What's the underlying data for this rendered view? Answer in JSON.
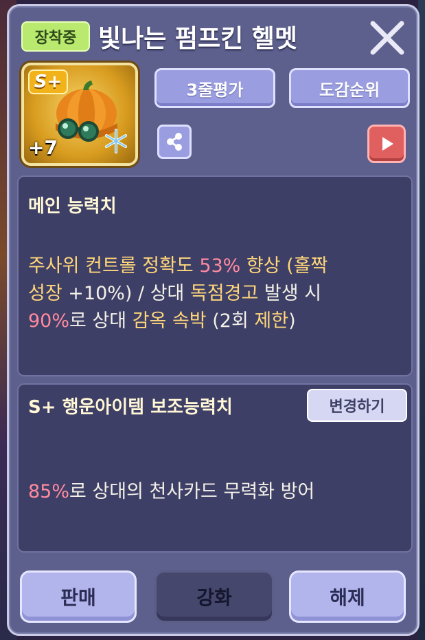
{
  "header": {
    "equipped_badge": "장착중",
    "title": "빛나는 펌프킨 헬멧"
  },
  "item": {
    "grade": "S+",
    "enhance_level": "+7",
    "icon": "pumpkin-helmet-icon",
    "element_icon": "snowflake-icon"
  },
  "actions": {
    "rating_label": "3줄평가",
    "ranking_label": "도감순위"
  },
  "main_stat": {
    "title": "메인 능력치",
    "line1_a": "주사위 컨트롤 정확도 ",
    "line1_b": "53%",
    "line1_c": " 향상 (",
    "line1_d": "홀짝",
    "line2_a": "성장",
    "line2_b": " +10%) / 상대 ",
    "line2_c": "독점경고",
    "line2_d": " 발생 시",
    "line3_a": "90%",
    "line3_b": "로 상대 ",
    "line3_c": "감옥 속박",
    "line3_d": " (2회 ",
    "line3_e": "제한",
    "line3_f": ")"
  },
  "sub_stat": {
    "title": "S+ 행운아이템 보조능력치",
    "change_label": "변경하기",
    "line1_a": "85%",
    "line1_b": "로 상대의 천사카드 무력화 방어"
  },
  "footer": {
    "sell_label": "판매",
    "enhance_label": "강화",
    "unequip_label": "해제"
  },
  "colors": {
    "panel": "#5d5f8c",
    "highlight_yellow": "#ffd67a",
    "highlight_pink": "#ff8aa0",
    "equipped_green": "#b9ea6f"
  }
}
